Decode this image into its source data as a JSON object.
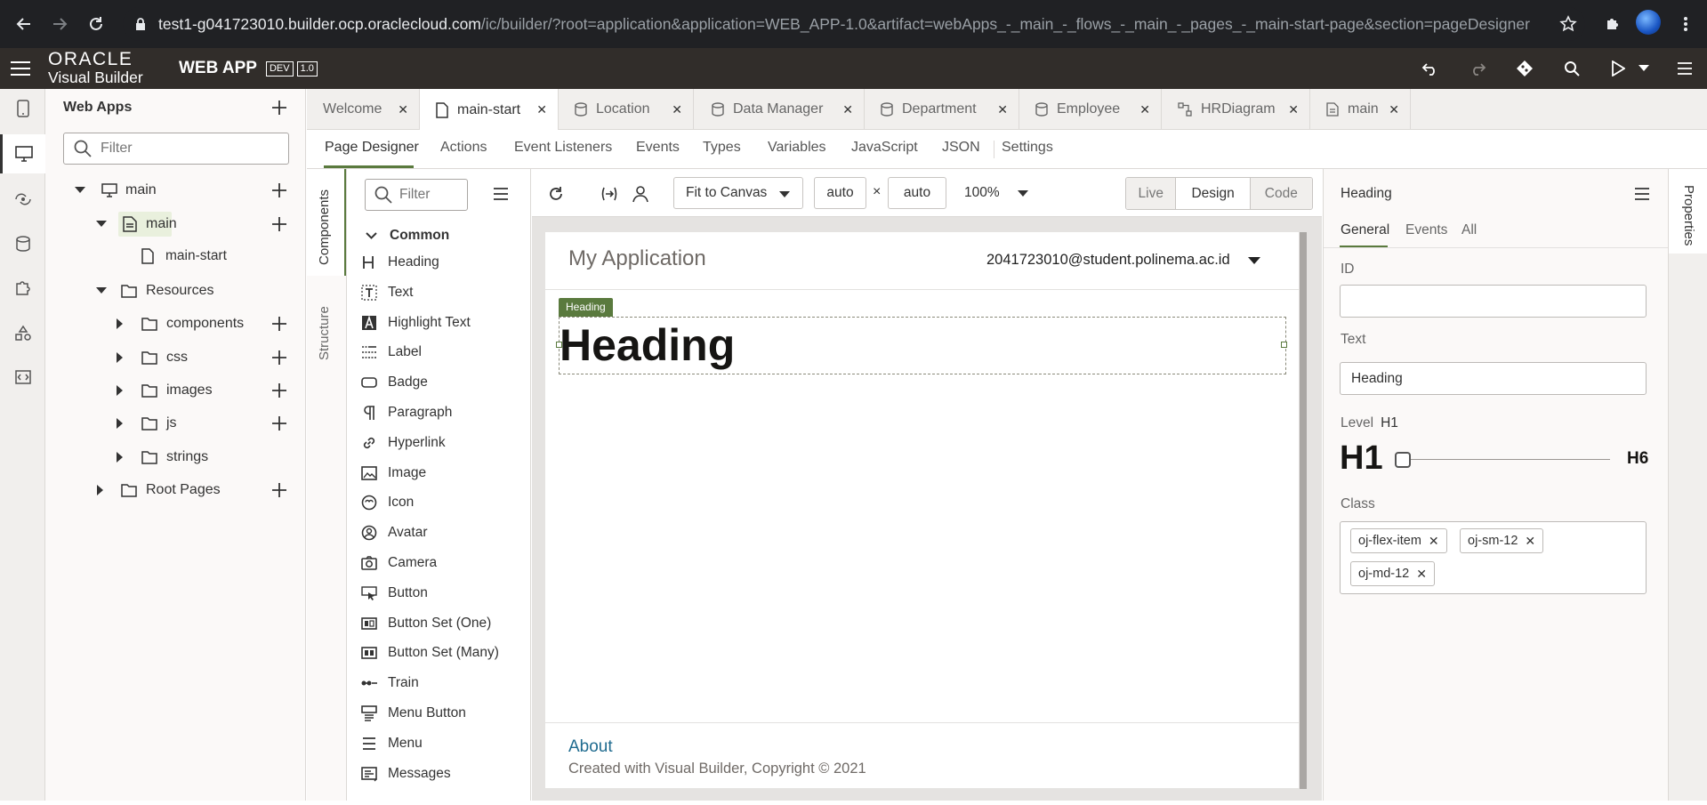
{
  "browser": {
    "url_host": "test1-g041723010.builder.ocp.oraclecloud.com",
    "url_path": "/ic/builder/?root=application&application=WEB_APP-1.0&artifact=webApps_-_main_-_flows_-_main_-_pages_-_main-start-page&section=pageDesigner"
  },
  "header": {
    "brand_top": "ORACLE",
    "brand_bottom": "Visual Builder",
    "app_name": "WEB APP",
    "dev_badge": "DEV",
    "version_badge": "1.0"
  },
  "nav": {
    "title": "Web Apps",
    "filter_placeholder": "Filter",
    "tree": [
      {
        "label": "main"
      },
      {
        "label": "main"
      },
      {
        "label": "main-start"
      },
      {
        "label": "Resources"
      },
      {
        "label": "components"
      },
      {
        "label": "css"
      },
      {
        "label": "images"
      },
      {
        "label": "js"
      },
      {
        "label": "strings"
      },
      {
        "label": "Root Pages"
      }
    ]
  },
  "tabs": [
    {
      "label": "Welcome"
    },
    {
      "label": "main-start"
    },
    {
      "label": "Location"
    },
    {
      "label": "Data Manager"
    },
    {
      "label": "Department"
    },
    {
      "label": "Employee"
    },
    {
      "label": "HRDiagram"
    },
    {
      "label": "main"
    }
  ],
  "subtabs": [
    "Page Designer",
    "Actions",
    "Event Listeners",
    "Events",
    "Types",
    "Variables",
    "JavaScript",
    "JSON",
    "Settings"
  ],
  "components": {
    "side_tabs": [
      "Components",
      "Structure"
    ],
    "filter_placeholder": "Filter",
    "group": "Common",
    "items": [
      "Heading",
      "Text",
      "Highlight Text",
      "Label",
      "Badge",
      "Paragraph",
      "Hyperlink",
      "Image",
      "Icon",
      "Avatar",
      "Camera",
      "Button",
      "Button Set (One)",
      "Button Set (Many)",
      "Train",
      "Menu Button",
      "Menu",
      "Messages"
    ]
  },
  "toolbar": {
    "fit": "Fit to Canvas",
    "width": "auto",
    "times": "×",
    "height": "auto",
    "zoom": "100%",
    "modes": [
      "Live",
      "Design",
      "Code"
    ]
  },
  "page": {
    "app_title": "My Application",
    "user": "2041723010@student.polinema.ac.id",
    "selected_tag": "Heading",
    "heading": "Heading",
    "footer_link": "About",
    "footer_text": "Created with Visual Builder, Copyright © 2021"
  },
  "props": {
    "title": "Heading",
    "tabs": [
      "General",
      "Events",
      "All"
    ],
    "id_label": "ID",
    "id_value": "",
    "text_label": "Text",
    "text_value": "Heading",
    "level_label": "Level",
    "level_value": "H1",
    "level_big": "H1",
    "level_end": "H6",
    "level_position": 0,
    "class_label": "Class",
    "classes": [
      "oj-flex-item",
      "oj-sm-12",
      "oj-md-12"
    ],
    "side_tab": "Properties"
  },
  "colors": {
    "header_bg": "#312d2a",
    "tag_green": "#5a7a3e",
    "link_blue": "#1f6b8f"
  }
}
